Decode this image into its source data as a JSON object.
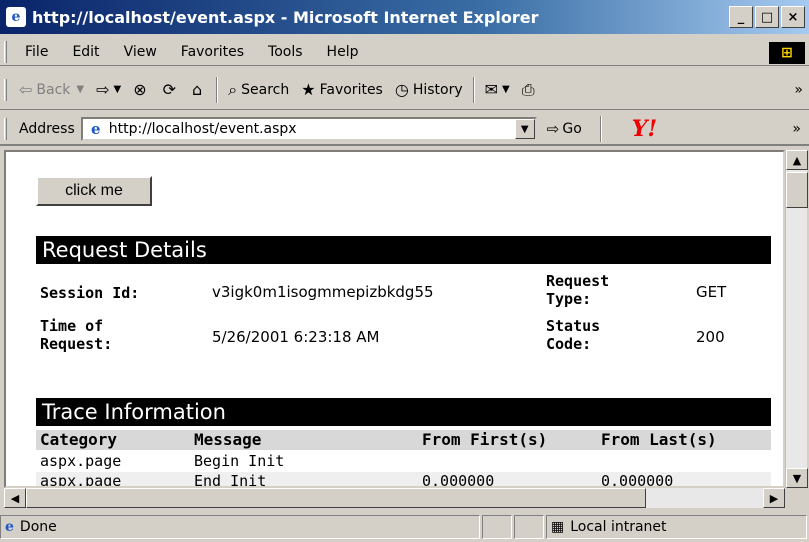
{
  "window": {
    "title": "http://localhost/event.aspx - Microsoft Internet Explorer",
    "min_label": "_",
    "max_label": "□",
    "close_label": "×"
  },
  "menu": [
    "File",
    "Edit",
    "View",
    "Favorites",
    "Tools",
    "Help"
  ],
  "toolbar": {
    "back": "Back",
    "search": "Search",
    "favorites": "Favorites",
    "history": "History"
  },
  "address": {
    "label": "Address",
    "url": "http://localhost/event.aspx",
    "go": "Go"
  },
  "page": {
    "button_label": "click me",
    "request_details": {
      "heading": "Request Details",
      "session_label": "Session Id:",
      "session_value": "v3igk0m1isogmmepizbkdg55",
      "request_type_label": "Request Type:",
      "request_type_value": "GET",
      "time_label": "Time of Request:",
      "time_value": "5/26/2001 6:23:18 AM",
      "status_label": "Status Code:",
      "status_value": "200"
    },
    "trace": {
      "heading": "Trace Information",
      "columns": [
        "Category",
        "Message",
        "From First(s)",
        "From Last(s)"
      ],
      "rows": [
        {
          "category": "aspx.page",
          "message": "Begin Init",
          "first": "",
          "last": ""
        },
        {
          "category": "aspx.page",
          "message": "End Init",
          "first": "0.000000",
          "last": "0.000000"
        }
      ]
    }
  },
  "status": {
    "text": "Done",
    "zone": "Local intranet"
  },
  "colors": {
    "titlebar": "#0a246a",
    "section_header": "#000000",
    "chrome": "#d4d0c8"
  }
}
